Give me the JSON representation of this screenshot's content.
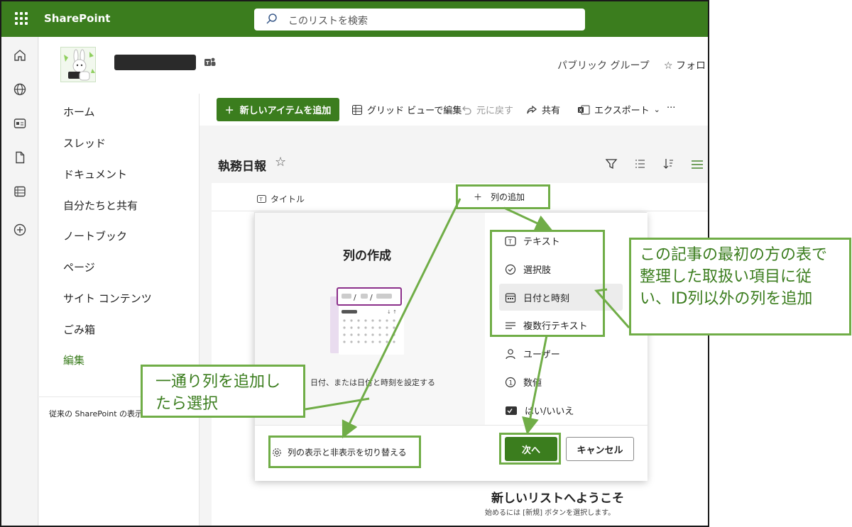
{
  "app": {
    "brand": "SharePoint",
    "accent": "#3b7d1e",
    "annotation_color": "#70ad47"
  },
  "search": {
    "placeholder": "このリストを検索"
  },
  "site": {
    "group_label": "パブリック グループ",
    "follow_label": "フォロ"
  },
  "nav": {
    "items": [
      {
        "label": "ホーム"
      },
      {
        "label": "スレッド"
      },
      {
        "label": "ドキュメント"
      },
      {
        "label": "自分たちと共有"
      },
      {
        "label": "ノートブック"
      },
      {
        "label": "ページ"
      },
      {
        "label": "サイト コンテンツ"
      },
      {
        "label": "ごみ箱"
      },
      {
        "label": "編集"
      }
    ],
    "classic_link": "従来の SharePoint の表示"
  },
  "commands": {
    "new_item": "新しいアイテムを追加",
    "grid_edit": "グリッド ビューで編集",
    "undo": "元に戻す",
    "share": "共有",
    "export": "エクスポート",
    "more": "···"
  },
  "list": {
    "title": "執務日報",
    "column_title": "タイトル",
    "add_column": "列の追加"
  },
  "panel": {
    "heading": "列の作成",
    "description": "日付、または日付と時刻を設定する",
    "types": [
      {
        "label": "テキスト",
        "icon": "text-icon"
      },
      {
        "label": "選択肢",
        "icon": "choice-icon"
      },
      {
        "label": "日付と時刻",
        "icon": "calendar-icon"
      },
      {
        "label": "複数行テキスト",
        "icon": "multiline-icon"
      },
      {
        "label": "ユーザー",
        "icon": "person-icon"
      },
      {
        "label": "数値",
        "icon": "number-icon"
      },
      {
        "label": "はい/いいえ",
        "icon": "yesno-icon"
      }
    ],
    "toggle_link": "列の表示と非表示を切り替える",
    "next": "次へ",
    "cancel": "キャンセル"
  },
  "welcome": {
    "title": "新しいリストへようこそ",
    "subtitle": "始めるには [新規] ボタンを選択します。"
  },
  "annotations": {
    "right": "この記事の最初の方の表で整理した取扱い項目に従い、ID列以外の列を追加",
    "left": "一通り列を追加したら選択"
  }
}
